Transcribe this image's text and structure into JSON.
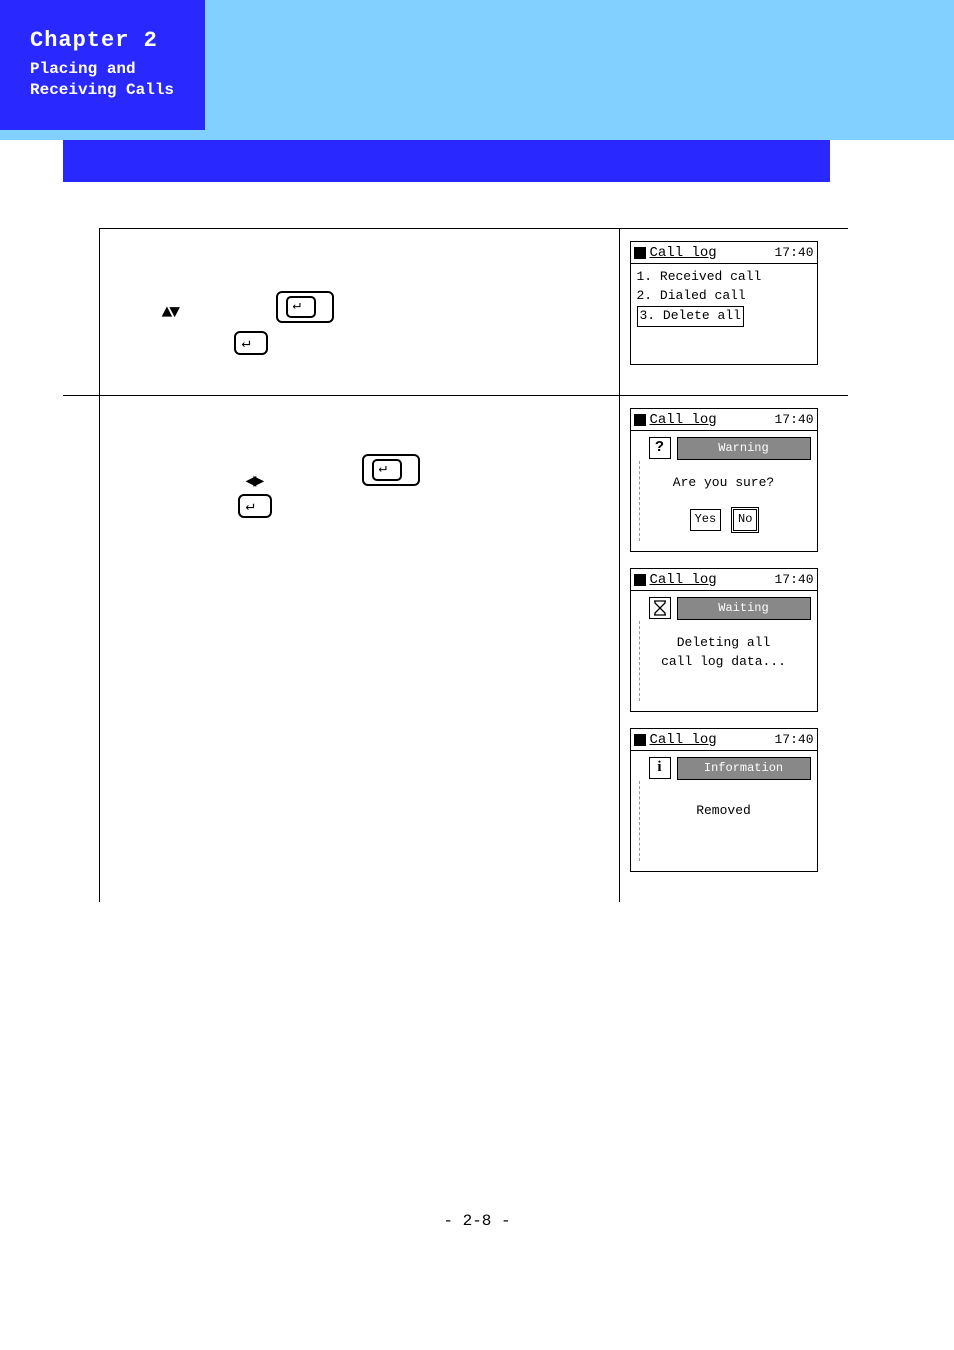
{
  "chapter": {
    "title": "Chapter 2",
    "subtitle": "Placing and\nReceiving Calls"
  },
  "screens": {
    "s1": {
      "title": "Call log",
      "time": "17:40",
      "line1": "1. Received call",
      "line2": "2. Dialed call",
      "line3": "3. Delete all"
    },
    "s2": {
      "title": "Call log",
      "time": "17:40",
      "dlg_label": "Warning",
      "icon": "?",
      "text": "Are you sure?",
      "yes": "Yes",
      "no": "No"
    },
    "s3": {
      "title": "Call log",
      "time": "17:40",
      "dlg_label": "Waiting",
      "text": "Deleting all\ncall log data..."
    },
    "s4": {
      "title": "Call log",
      "time": "17:40",
      "dlg_label": "Information",
      "icon": "i",
      "text": "Removed"
    }
  },
  "page_number": "- 2-8 -"
}
